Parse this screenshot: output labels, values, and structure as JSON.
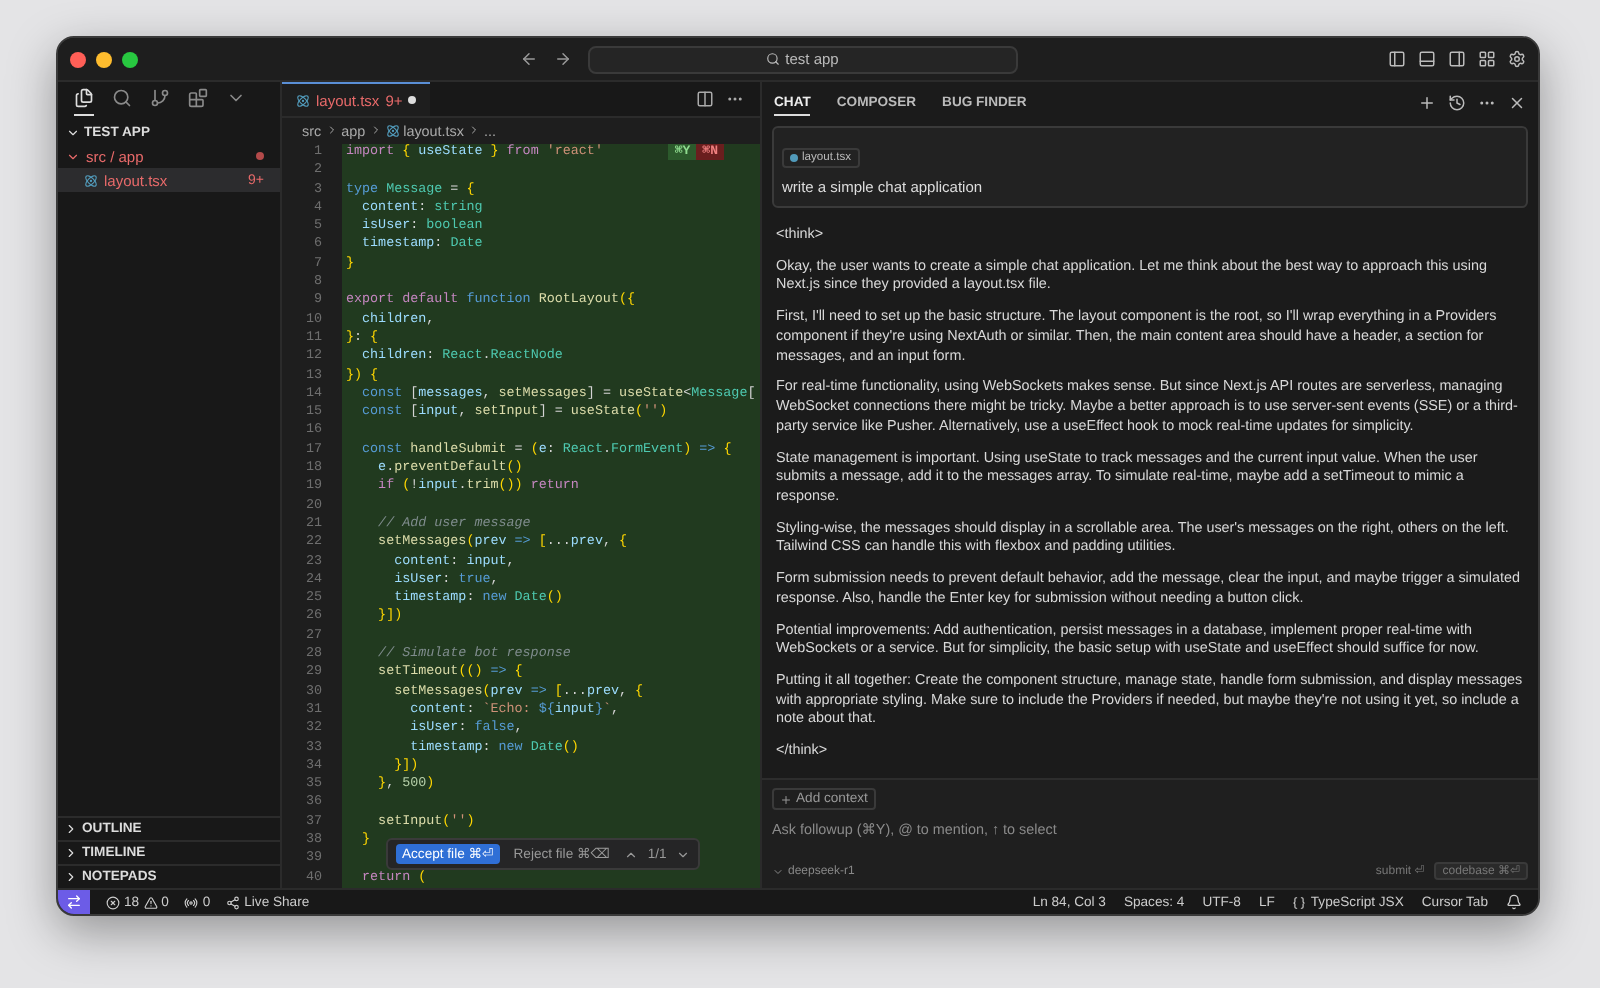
{
  "title_bar": {
    "search_value": "test app"
  },
  "activity_bar": [
    {
      "kind": "files",
      "selected": true
    },
    {
      "kind": "search",
      "selected": false
    },
    {
      "kind": "git",
      "selected": false
    },
    {
      "kind": "extensions",
      "selected": false
    },
    {
      "kind": "more",
      "selected": false
    }
  ],
  "explorer": {
    "title": "TEST APP",
    "folder": {
      "label": "src / app",
      "expanded": true,
      "modified": true,
      "children": [
        {
          "label": "layout.tsx",
          "badge": "9+",
          "selected": true
        }
      ]
    }
  },
  "panels": [
    {
      "label": "OUTLINE",
      "expanded": false
    },
    {
      "label": "TIMELINE",
      "expanded": false
    },
    {
      "label": "NOTEPADS",
      "expanded": false
    }
  ],
  "editor": {
    "tabs": [
      {
        "label": "layout.tsx",
        "badge": "9+",
        "modified": true,
        "selected": true
      }
    ],
    "breadcrumb": [
      "src",
      "app",
      "layout.tsx",
      "..."
    ],
    "inline_keys": [
      {
        "label": "⌘Y",
        "kind": "accept"
      },
      {
        "label": "⌘N",
        "kind": "reject"
      }
    ],
    "lines": [
      {
        "number": "1",
        "tokens": [
          {
            "kind": "control",
            "text": "import "
          },
          {
            "kind": "bracket",
            "text": "{"
          },
          {
            "kind": "variable",
            "text": " useState "
          },
          {
            "kind": "bracket",
            "text": "}"
          },
          {
            "kind": "control",
            "text": " from "
          },
          {
            "kind": "string",
            "text": "'react'"
          }
        ]
      },
      {
        "number": "2"
      },
      {
        "number": "3",
        "tokens": [
          {
            "kind": "keyword",
            "text": "type "
          },
          {
            "kind": "type",
            "text": "Message"
          },
          {
            "kind": "plain",
            "text": " = "
          },
          {
            "kind": "bracket",
            "text": "{"
          }
        ]
      },
      {
        "number": "4",
        "tokens": [
          {
            "kind": "variable",
            "text": "  content"
          },
          {
            "kind": "plain",
            "text": ": "
          },
          {
            "kind": "type",
            "text": "string"
          }
        ]
      },
      {
        "number": "5",
        "tokens": [
          {
            "kind": "variable",
            "text": "  isUser"
          },
          {
            "kind": "plain",
            "text": ": "
          },
          {
            "kind": "type",
            "text": "boolean"
          }
        ]
      },
      {
        "number": "6",
        "tokens": [
          {
            "kind": "variable",
            "text": "  timestamp"
          },
          {
            "kind": "plain",
            "text": ": "
          },
          {
            "kind": "type",
            "text": "Date"
          }
        ]
      },
      {
        "number": "7",
        "tokens": [
          {
            "kind": "bracket",
            "text": "}"
          }
        ]
      },
      {
        "number": "8"
      },
      {
        "number": "9",
        "tokens": [
          {
            "kind": "control",
            "text": "export default "
          },
          {
            "kind": "keyword",
            "text": "function "
          },
          {
            "kind": "function",
            "text": "RootLayout"
          },
          {
            "kind": "bracket",
            "text": "({"
          }
        ]
      },
      {
        "number": "10",
        "tokens": [
          {
            "kind": "variable",
            "text": "  children"
          },
          {
            "kind": "plain",
            "text": ","
          }
        ]
      },
      {
        "number": "11",
        "tokens": [
          {
            "kind": "bracket",
            "text": "}"
          },
          {
            "kind": "plain",
            "text": ": "
          },
          {
            "kind": "bracket",
            "text": "{"
          }
        ]
      },
      {
        "number": "12",
        "tokens": [
          {
            "kind": "variable",
            "text": "  children"
          },
          {
            "kind": "plain",
            "text": ": "
          },
          {
            "kind": "type",
            "text": "React"
          },
          {
            "kind": "plain",
            "text": "."
          },
          {
            "kind": "type",
            "text": "ReactNode"
          }
        ]
      },
      {
        "number": "13",
        "tokens": [
          {
            "kind": "bracket",
            "text": "})"
          },
          {
            "kind": "bracket",
            "text": " {"
          }
        ]
      },
      {
        "number": "14",
        "tokens": [
          {
            "kind": "keyword",
            "text": "  const "
          },
          {
            "kind": "plain",
            "text": "["
          },
          {
            "kind": "variable",
            "text": "messages"
          },
          {
            "kind": "plain",
            "text": ", "
          },
          {
            "kind": "function",
            "text": "setMessages"
          },
          {
            "kind": "plain",
            "text": "] = "
          },
          {
            "kind": "function",
            "text": "useState"
          },
          {
            "kind": "plain",
            "text": "<"
          },
          {
            "kind": "type",
            "text": "Message"
          },
          {
            "kind": "plain",
            "text": "["
          }
        ]
      },
      {
        "number": "15",
        "tokens": [
          {
            "kind": "keyword",
            "text": "  const "
          },
          {
            "kind": "plain",
            "text": "["
          },
          {
            "kind": "variable",
            "text": "input"
          },
          {
            "kind": "plain",
            "text": ", "
          },
          {
            "kind": "function",
            "text": "setInput"
          },
          {
            "kind": "plain",
            "text": "] = "
          },
          {
            "kind": "function",
            "text": "useState"
          },
          {
            "kind": "bracket",
            "text": "("
          },
          {
            "kind": "string",
            "text": "''"
          },
          {
            "kind": "bracket",
            "text": ")"
          }
        ]
      },
      {
        "number": "16"
      },
      {
        "number": "17",
        "tokens": [
          {
            "kind": "keyword",
            "text": "  const "
          },
          {
            "kind": "function",
            "text": "handleSubmit"
          },
          {
            "kind": "plain",
            "text": " = "
          },
          {
            "kind": "bracket",
            "text": "("
          },
          {
            "kind": "variable",
            "text": "e"
          },
          {
            "kind": "plain",
            "text": ": "
          },
          {
            "kind": "type",
            "text": "React"
          },
          {
            "kind": "plain",
            "text": "."
          },
          {
            "kind": "type",
            "text": "FormEvent"
          },
          {
            "kind": "bracket",
            "text": ")"
          },
          {
            "kind": "keyword",
            "text": " => "
          },
          {
            "kind": "bracket",
            "text": "{"
          }
        ]
      },
      {
        "number": "18",
        "tokens": [
          {
            "kind": "variable",
            "text": "    e"
          },
          {
            "kind": "plain",
            "text": "."
          },
          {
            "kind": "function",
            "text": "preventDefault"
          },
          {
            "kind": "bracket",
            "text": "()"
          }
        ]
      },
      {
        "number": "19",
        "tokens": [
          {
            "kind": "control",
            "text": "    if "
          },
          {
            "kind": "bracket",
            "text": "("
          },
          {
            "kind": "plain",
            "text": "!"
          },
          {
            "kind": "variable",
            "text": "input"
          },
          {
            "kind": "plain",
            "text": "."
          },
          {
            "kind": "function",
            "text": "trim"
          },
          {
            "kind": "bracket",
            "text": "())"
          },
          {
            "kind": "control",
            "text": " return"
          }
        ]
      },
      {
        "number": "20"
      },
      {
        "number": "21",
        "tokens": [
          {
            "kind": "comment",
            "text": "    // Add user message"
          }
        ]
      },
      {
        "number": "22",
        "tokens": [
          {
            "kind": "function",
            "text": "    setMessages"
          },
          {
            "kind": "bracket",
            "text": "("
          },
          {
            "kind": "variable",
            "text": "prev"
          },
          {
            "kind": "keyword",
            "text": " => "
          },
          {
            "kind": "bracket",
            "text": "["
          },
          {
            "kind": "plain",
            "text": "..."
          },
          {
            "kind": "variable",
            "text": "prev"
          },
          {
            "kind": "plain",
            "text": ", "
          },
          {
            "kind": "bracket",
            "text": "{"
          }
        ]
      },
      {
        "number": "23",
        "tokens": [
          {
            "kind": "variable",
            "text": "      content"
          },
          {
            "kind": "plain",
            "text": ": "
          },
          {
            "kind": "variable",
            "text": "input"
          },
          {
            "kind": "plain",
            "text": ","
          }
        ]
      },
      {
        "number": "24",
        "tokens": [
          {
            "kind": "variable",
            "text": "      isUser"
          },
          {
            "kind": "plain",
            "text": ": "
          },
          {
            "kind": "keyword",
            "text": "true"
          },
          {
            "kind": "plain",
            "text": ","
          }
        ]
      },
      {
        "number": "25",
        "tokens": [
          {
            "kind": "variable",
            "text": "      timestamp"
          },
          {
            "kind": "plain",
            "text": ": "
          },
          {
            "kind": "keyword",
            "text": "new "
          },
          {
            "kind": "type",
            "text": "Date"
          },
          {
            "kind": "bracket",
            "text": "()"
          }
        ]
      },
      {
        "number": "26",
        "tokens": [
          {
            "kind": "bracket",
            "text": "    }])"
          }
        ]
      },
      {
        "number": "27"
      },
      {
        "number": "28",
        "tokens": [
          {
            "kind": "comment",
            "text": "    // Simulate bot response"
          }
        ]
      },
      {
        "number": "29",
        "tokens": [
          {
            "kind": "function",
            "text": "    setTimeout"
          },
          {
            "kind": "bracket",
            "text": "(()"
          },
          {
            "kind": "keyword",
            "text": " => "
          },
          {
            "kind": "bracket",
            "text": "{"
          }
        ]
      },
      {
        "number": "30",
        "tokens": [
          {
            "kind": "function",
            "text": "      setMessages"
          },
          {
            "kind": "bracket",
            "text": "("
          },
          {
            "kind": "variable",
            "text": "prev"
          },
          {
            "kind": "keyword",
            "text": " => "
          },
          {
            "kind": "bracket",
            "text": "["
          },
          {
            "kind": "plain",
            "text": "..."
          },
          {
            "kind": "variable",
            "text": "prev"
          },
          {
            "kind": "plain",
            "text": ", "
          },
          {
            "kind": "bracket",
            "text": "{"
          }
        ]
      },
      {
        "number": "31",
        "tokens": [
          {
            "kind": "variable",
            "text": "        content"
          },
          {
            "kind": "plain",
            "text": ": "
          },
          {
            "kind": "string",
            "text": "`Echo: "
          },
          {
            "kind": "keyword",
            "text": "${"
          },
          {
            "kind": "variable",
            "text": "input"
          },
          {
            "kind": "keyword",
            "text": "}"
          },
          {
            "kind": "string",
            "text": "`"
          },
          {
            "kind": "plain",
            "text": ","
          }
        ]
      },
      {
        "number": "32",
        "tokens": [
          {
            "kind": "variable",
            "text": "        isUser"
          },
          {
            "kind": "plain",
            "text": ": "
          },
          {
            "kind": "keyword",
            "text": "false"
          },
          {
            "kind": "plain",
            "text": ","
          }
        ]
      },
      {
        "number": "33",
        "tokens": [
          {
            "kind": "variable",
            "text": "        timestamp"
          },
          {
            "kind": "plain",
            "text": ": "
          },
          {
            "kind": "keyword",
            "text": "new "
          },
          {
            "kind": "type",
            "text": "Date"
          },
          {
            "kind": "bracket",
            "text": "()"
          }
        ]
      },
      {
        "number": "34",
        "tokens": [
          {
            "kind": "bracket",
            "text": "      }])"
          }
        ]
      },
      {
        "number": "35",
        "tokens": [
          {
            "kind": "bracket",
            "text": "    }"
          },
          {
            "kind": "plain",
            "text": ", "
          },
          {
            "kind": "number",
            "text": "500"
          },
          {
            "kind": "bracket",
            "text": ")"
          }
        ]
      },
      {
        "number": "36"
      },
      {
        "number": "37",
        "tokens": [
          {
            "kind": "function",
            "text": "    setInput"
          },
          {
            "kind": "bracket",
            "text": "("
          },
          {
            "kind": "string",
            "text": "''"
          },
          {
            "kind": "bracket",
            "text": ")"
          }
        ]
      },
      {
        "number": "38",
        "tokens": [
          {
            "kind": "bracket",
            "text": "  }"
          }
        ]
      },
      {
        "number": "39"
      },
      {
        "number": "40",
        "tokens": [
          {
            "kind": "control",
            "text": "  return "
          },
          {
            "kind": "bracket",
            "text": "("
          }
        ]
      }
    ],
    "review_bar": {
      "accept": "Accept file ⌘⏎",
      "reject": "Reject file ⌘⌫",
      "count": "1/1"
    }
  },
  "chat": {
    "tabs": [
      {
        "label": "CHAT",
        "selected": true
      },
      {
        "label": "COMPOSER",
        "selected": false
      },
      {
        "label": "BUG FINDER",
        "selected": false
      }
    ],
    "prompt": {
      "file_chip": "layout.tsx",
      "text": "write a simple chat application"
    },
    "response": [
      "<think>",
      "Okay, the user wants to create a simple chat application. Let me think about the best way to approach this using Next.js since they provided a layout.tsx file.",
      "First, I'll need to set up the basic structure. The layout component is the root, so I'll wrap everything in a Providers component if they're using NextAuth or similar. Then, the main content area should have a header, a section for messages, and an input form.",
      "For real-time functionality, using WebSockets makes sense. But since Next.js API routes are serverless, managing WebSocket connections there might be tricky. Maybe a better approach is to use server-sent events (SSE) or a third-party service like Pusher. Alternatively, use a useEffect hook to mock real-time updates for simplicity.",
      "State management is important. Using useState to track messages and the current input value. When the user submits a message, add it to the messages array. To simulate real-time, maybe add a setTimeout to mimic a response.",
      "Styling-wise, the messages should display in a scrollable area. The user's messages on the right, others on the left. Tailwind CSS can handle this with flexbox and padding utilities.",
      "Form submission needs to prevent default behavior, add the message, clear the input, and maybe trigger a simulated response. Also, handle the Enter key for submission without needing a button click.",
      "Potential improvements: Add authentication, persist messages in a database, implement proper real-time with WebSockets or a service. But for simplicity, the basic setup with useState and useEffect should suffice for now.",
      "Putting it all together: Create the component structure, manage state, handle form submission, and display messages with appropriate styling. Make sure to include the Providers if needed, but maybe they're not using it yet, so include a note about that.",
      "</think>"
    ],
    "composer": {
      "add_context": "Add context",
      "placeholder": "Ask followup (⌘Y), @ to mention, ↑ to select",
      "model": "deepseek-r1",
      "submit": "submit ⏎",
      "codebase": "codebase ⌘⏎"
    }
  },
  "status_bar": {
    "errors": "18",
    "warnings": "0",
    "ports": "0",
    "live_share": "Live Share",
    "items": [
      "Ln 84, Col 3",
      "Spaces: 4",
      "UTF-8",
      "LF"
    ],
    "language": "TypeScript JSX",
    "cursor_tab": "Cursor Tab"
  }
}
